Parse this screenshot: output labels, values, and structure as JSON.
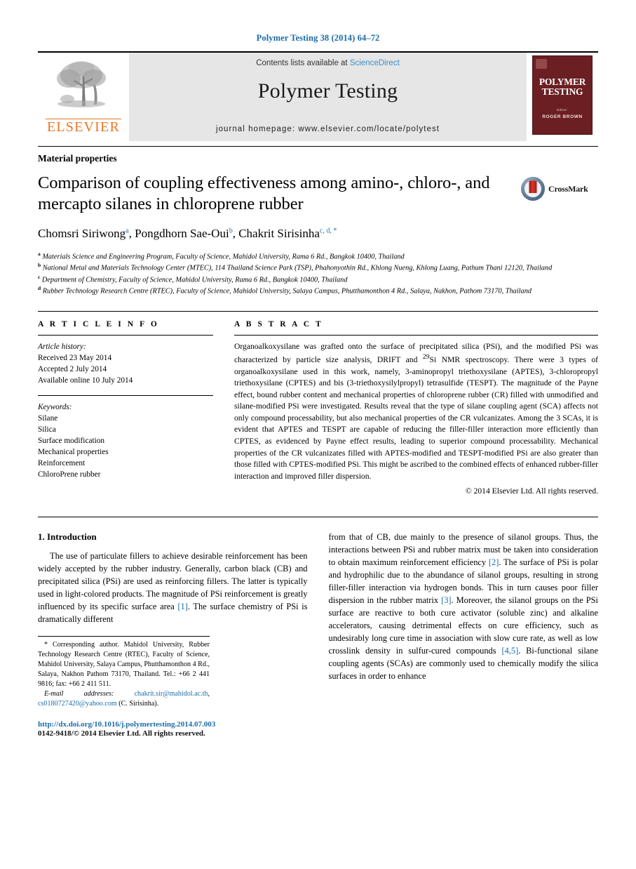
{
  "running_head": "Polymer Testing 38 (2014) 64–72",
  "masthead": {
    "contents_prefix": "Contents lists available at ",
    "contents_link": "ScienceDirect",
    "journal_title": "Polymer Testing",
    "homepage": "journal homepage: www.elsevier.com/locate/polytest",
    "publisher_logo_text": "ELSEVIER",
    "publisher_logo_icon": "elsevier-tree-icon",
    "cover": {
      "title_line1": "POLYMER",
      "title_line2": "TESTING",
      "editor_label": "Editor:",
      "editor_name": "ROGER BROWN",
      "background_color": "#6b1f22"
    }
  },
  "article": {
    "kicker": "Material properties",
    "title": "Comparison of coupling effectiveness among amino-, chloro-, and mercapto silanes in chloroprene rubber",
    "authors": [
      {
        "name": "Chomsri Siriwong",
        "marks": "a"
      },
      {
        "name": "Pongdhorn Sae-Oui",
        "marks": "b"
      },
      {
        "name": "Chakrit Sirisinha",
        "marks": "c, d, *"
      }
    ],
    "crossmark_label": "CrossMark",
    "crossmark_icon": "crossmark-icon",
    "affiliations": [
      {
        "mark": "a",
        "text": "Materials Science and Engineering Program, Faculty of Science, Mahidol University, Rama 6 Rd., Bangkok 10400, Thailand"
      },
      {
        "mark": "b",
        "text": "National Metal and Materials Technology Center (MTEC), 114 Thailand Science Park (TSP), Phahonyothin Rd., Khlong Nueng, Khlong Luang, Pathum Thani 12120, Thailand"
      },
      {
        "mark": "c",
        "text": "Department of Chemistry, Faculty of Science, Mahidol University, Rama 6 Rd., Bangkok 10400, Thailand"
      },
      {
        "mark": "d",
        "text": "Rubber Technology Research Centre (RTEC), Faculty of Science, Mahidol University, Salaya Campus, Phutthamonthon 4 Rd., Salaya, Nakhon, Pathom 73170, Thailand"
      }
    ]
  },
  "article_info": {
    "heading": "A R T I C L E   I N F O",
    "history_label": "Article history:",
    "history": [
      "Received 23 May 2014",
      "Accepted 2 July 2014",
      "Available online 10 July 2014"
    ],
    "keywords_label": "Keywords:",
    "keywords": [
      "Silane",
      "Silica",
      "Surface modification",
      "Mechanical properties",
      "Reinforcement",
      "ChloroPrene rubber"
    ]
  },
  "abstract": {
    "heading": "A B S T R A C T",
    "text": "Organoalkoxysilane was grafted onto the surface of precipitated silica (PSi), and the modified PSi was characterized by particle size analysis, DRIFT and 29Si NMR spectroscopy. There were 3 types of organoalkoxysilane used in this work, namely, 3-aminopropyl triethoxysilane (APTES), 3-chloropropyl triethoxysilane (CPTES) and bis (3-triethoxysilylpropyl) tetrasulfide (TESPT). The magnitude of the Payne effect, bound rubber content and mechanical properties of chloroprene rubber (CR) filled with unmodified and silane-modified PSi were investigated. Results reveal that the type of silane coupling agent (SCA) affects not only compound processability, but also mechanical properties of the CR vulcanizates. Among the 3 SCAs, it is evident that APTES and TESPT are capable of reducing the filler-filler interaction more efficiently than CPTES, as evidenced by Payne effect results, leading to superior compound processability. Mechanical properties of the CR vulcanizates filled with APTES-modified and TESPT-modified PSi are also greater than those filled with CPTES-modified PSi. This might be ascribed to the combined effects of enhanced rubber-filler interaction and improved filler dispersion.",
    "copyright": "© 2014 Elsevier Ltd. All rights reserved."
  },
  "introduction": {
    "heading": "1. Introduction",
    "left_paragraph_pre": "The use of particulate fillers to achieve desirable reinforcement has been widely accepted by the rubber industry. Generally, carbon black (CB) and precipitated silica (PSi) are used as reinforcing fillers. The latter is typically used in light-colored products. The magnitude of PSi reinforcement is greatly influenced by its specific surface area ",
    "left_ref_1": "[1]",
    "left_paragraph_post": ". The surface chemistry of PSi is dramatically different",
    "right_segments": [
      {
        "type": "text",
        "value": "from that of CB, due mainly to the presence of silanol groups. Thus, the interactions between PSi and rubber matrix must be taken into consideration to obtain maximum reinforcement efficiency "
      },
      {
        "type": "ref",
        "value": "[2]"
      },
      {
        "type": "text",
        "value": ". The surface of PSi is polar and hydrophilic due to the abundance of silanol groups, resulting in strong filler-filler interaction via hydrogen bonds. This in turn causes poor filler dispersion in the rubber matrix "
      },
      {
        "type": "ref",
        "value": "[3]"
      },
      {
        "type": "text",
        "value": ". Moreover, the silanol groups on the PSi surface are reactive to both cure activator (soluble zinc) and alkaline accelerators, causing detrimental effects on cure efficiency, such as undesirably long cure time in association with slow cure rate, as well as low crosslink density in sulfur-cured compounds "
      },
      {
        "type": "ref",
        "value": "[4,5]"
      },
      {
        "type": "text",
        "value": ". Bi-functional silane coupling agents (SCAs) are commonly used to chemically modify the silica surfaces in order to enhance"
      }
    ]
  },
  "footnote": {
    "marker": "*",
    "corresponding": " Corresponding author. Mahidol University, Rubber Technology Research Centre (RTEC), Faculty of Science, Mahidol University, Salaya Campus, Phutthamonthon 4 Rd., Salaya, Nakhon Pathom 73170, Thailand. Tel.: +66 2 441 9816; fax: +66 2 411 511.",
    "email_label": "E-mail addresses:",
    "email_1": "chakrit.sir@mahidol.ac.th",
    "email_2": "cs0180727420@yahoo.com",
    "email_suffix": "(C. Sirisinha)."
  },
  "bottom": {
    "doi": "http://dx.doi.org/10.1016/j.polymertesting.2014.07.003",
    "issn_line": "0142-9418/© 2014 Elsevier Ltd. All rights reserved."
  },
  "colors": {
    "link_blue": "#1b6ca8",
    "sciencedirect_blue": "#3c8dc5",
    "elsevier_orange": "#e87722",
    "cover_maroon": "#6b1f22",
    "masthead_grey": "#e6e6e6"
  }
}
